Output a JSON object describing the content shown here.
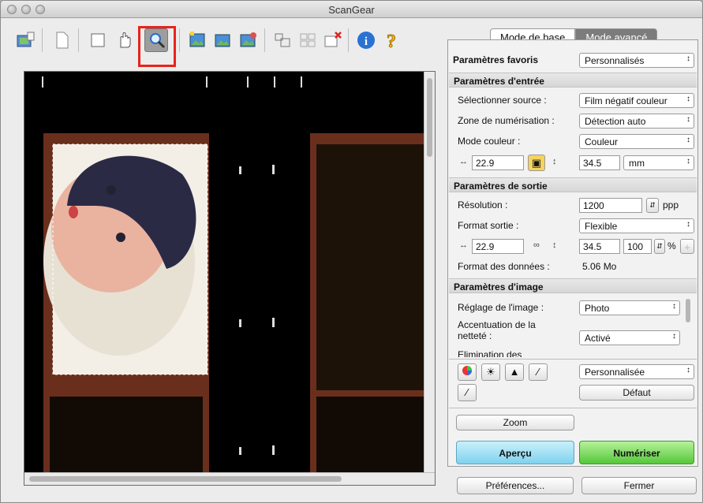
{
  "window": {
    "title": "ScanGear"
  },
  "tabs": {
    "basic": "Mode de base",
    "advanced": "Mode avancé"
  },
  "favorites": {
    "label": "Paramètres favoris",
    "value": "Personnalisés"
  },
  "input": {
    "header": "Paramètres d'entrée",
    "source_label": "Sélectionner source :",
    "source_value": "Film négatif couleur",
    "area_label": "Zone de numérisation :",
    "area_value": "Détection auto",
    "color_label": "Mode couleur :",
    "color_value": "Couleur",
    "width": "22.9",
    "height": "34.5",
    "unit": "mm"
  },
  "output": {
    "header": "Paramètres de sortie",
    "res_label": "Résolution :",
    "res_value": "1200",
    "res_unit": "ppp",
    "size_label": "Format sortie :",
    "size_value": "Flexible",
    "width": "22.9",
    "height": "34.5",
    "scale": "100",
    "scale_unit": "%",
    "data_label": "Format des données :",
    "data_value": "5.06 Mo"
  },
  "image": {
    "header": "Paramètres d'image",
    "adjust_label": "Réglage de l'image :",
    "adjust_value": "Photo",
    "sharp_label_1": "Accentuation de la",
    "sharp_label_2": "netteté :",
    "sharp_value": "Activé",
    "elim_label": "Elimination des"
  },
  "tone": {
    "preset": "Personnalisée",
    "default_btn": "Défaut"
  },
  "buttons": {
    "zoom": "Zoom",
    "preview": "Aperçu",
    "scan": "Numériser",
    "prefs": "Préférences...",
    "close": "Fermer"
  },
  "toolbar": {
    "icons": [
      "rotate-image-icon",
      "clear-icon",
      "crop-icon",
      "move-hand-icon",
      "zoom-icon",
      "auto-crop-icon",
      "select-all-icon",
      "invert-icon",
      "multi-crop-icon",
      "thumbnail-icon",
      "remove-crop-icon",
      "info-icon",
      "help-icon"
    ]
  }
}
